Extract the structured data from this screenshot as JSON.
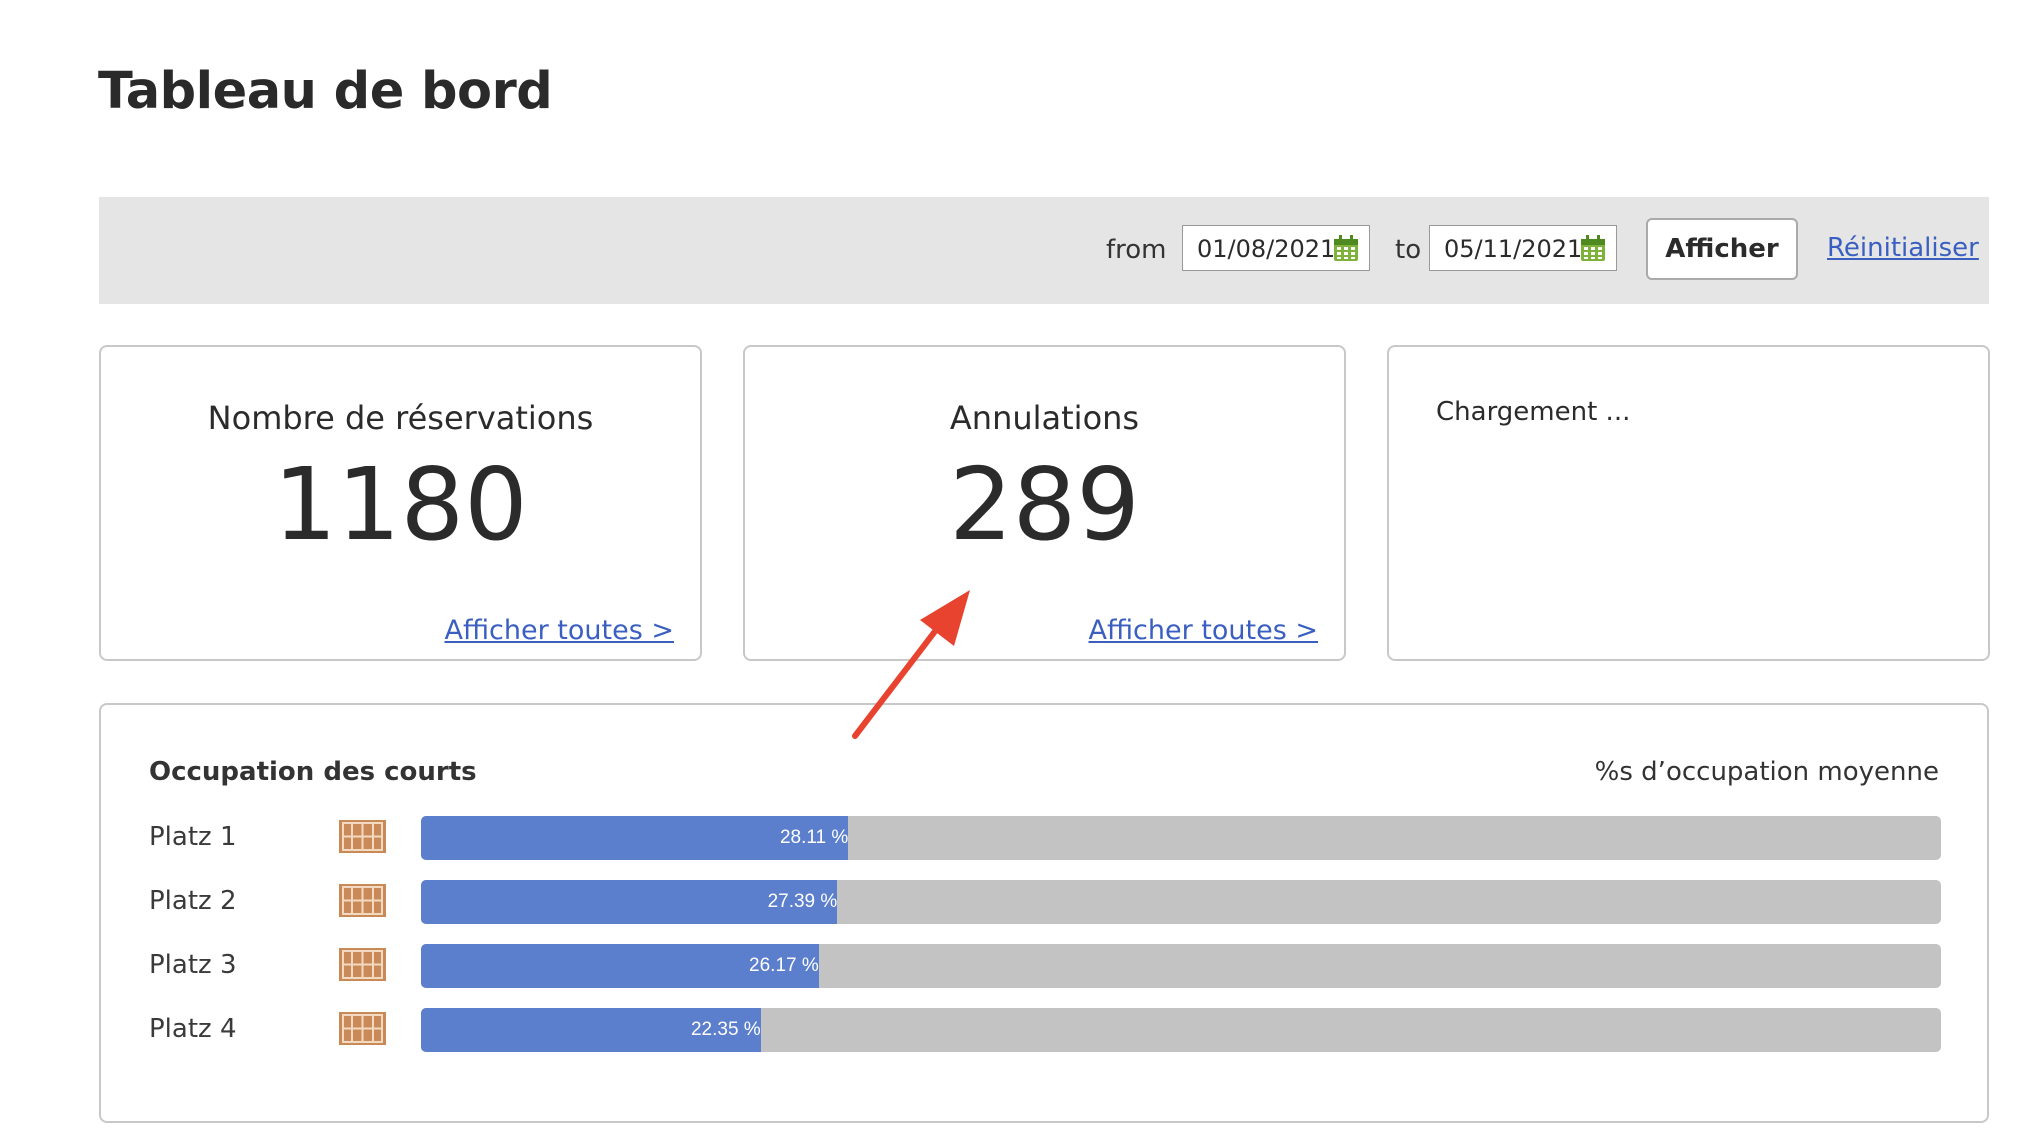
{
  "page": {
    "title": "Tableau de bord"
  },
  "filter": {
    "from_label": "from",
    "from_date": "01/08/2021",
    "to_label": "to",
    "to_date": "05/11/2021",
    "submit_label": "Afficher",
    "reset_label": "Réinitialiser"
  },
  "cards": {
    "reservations": {
      "title": "Nombre de réservations",
      "value": "1180",
      "link": "Afficher toutes >"
    },
    "cancellations": {
      "title": "Annulations",
      "value": "289",
      "link": "Afficher toutes >"
    },
    "loading": {
      "text": "Chargement ..."
    }
  },
  "occupation": {
    "title": "Occupation des courts",
    "subtitle": "%s d’occupation moyenne",
    "courts": [
      {
        "name": "Platz 1",
        "percent": 28.11,
        "label": "28.11 %"
      },
      {
        "name": "Platz 2",
        "percent": 27.39,
        "label": "27.39 %"
      },
      {
        "name": "Platz 3",
        "percent": 26.17,
        "label": "26.17 %"
      },
      {
        "name": "Platz 4",
        "percent": 22.35,
        "label": "22.35 %"
      }
    ]
  },
  "colors": {
    "bar_fill": "#5b7fcd",
    "bar_track": "#c3c3c3",
    "link": "#3a5fc0",
    "annotation_arrow": "#e8432e",
    "court_icon": "#c98a57"
  },
  "icons": {
    "calendar": "calendar-icon",
    "court": "court-icon",
    "annotation": "arrow-icon"
  }
}
